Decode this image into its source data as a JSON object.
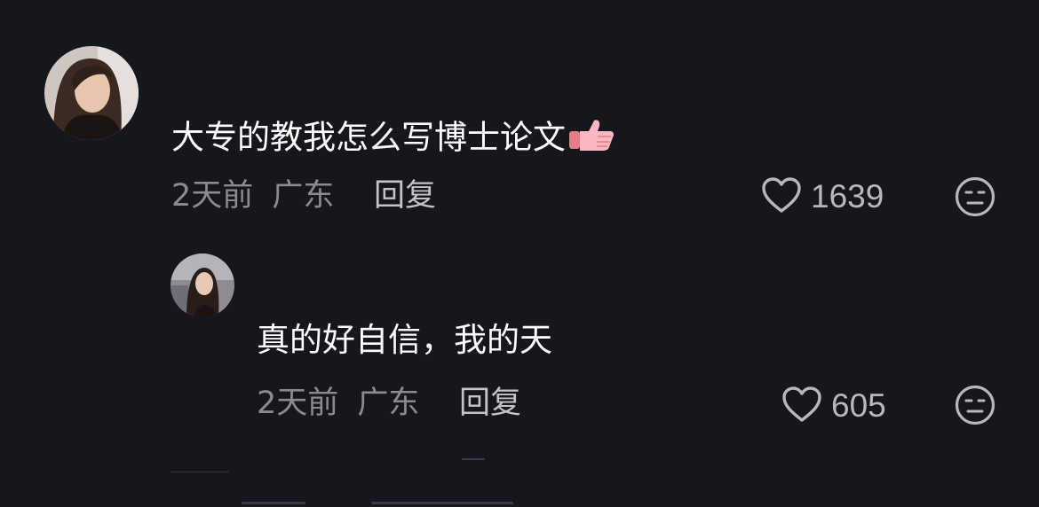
{
  "comments": [
    {
      "text": "大专的教我怎么写博士论文",
      "emoji": "👍",
      "time": "2天前",
      "location": "广东",
      "reply_label": "回复",
      "likes": "1639"
    }
  ],
  "reply": {
    "text": "真的好自信，我的天",
    "time": "2天前",
    "location": "广东",
    "reply_label": "回复",
    "likes": "605"
  },
  "icons": {
    "like": "heart-outline-icon",
    "dislike": "meh-face-icon"
  },
  "colors": {
    "background": "#16161d",
    "text_primary": "#ffffff",
    "text_secondary": "#8a8a90",
    "like_count": "#b8b8bc",
    "emoji_accent": "#f2a6ad"
  }
}
